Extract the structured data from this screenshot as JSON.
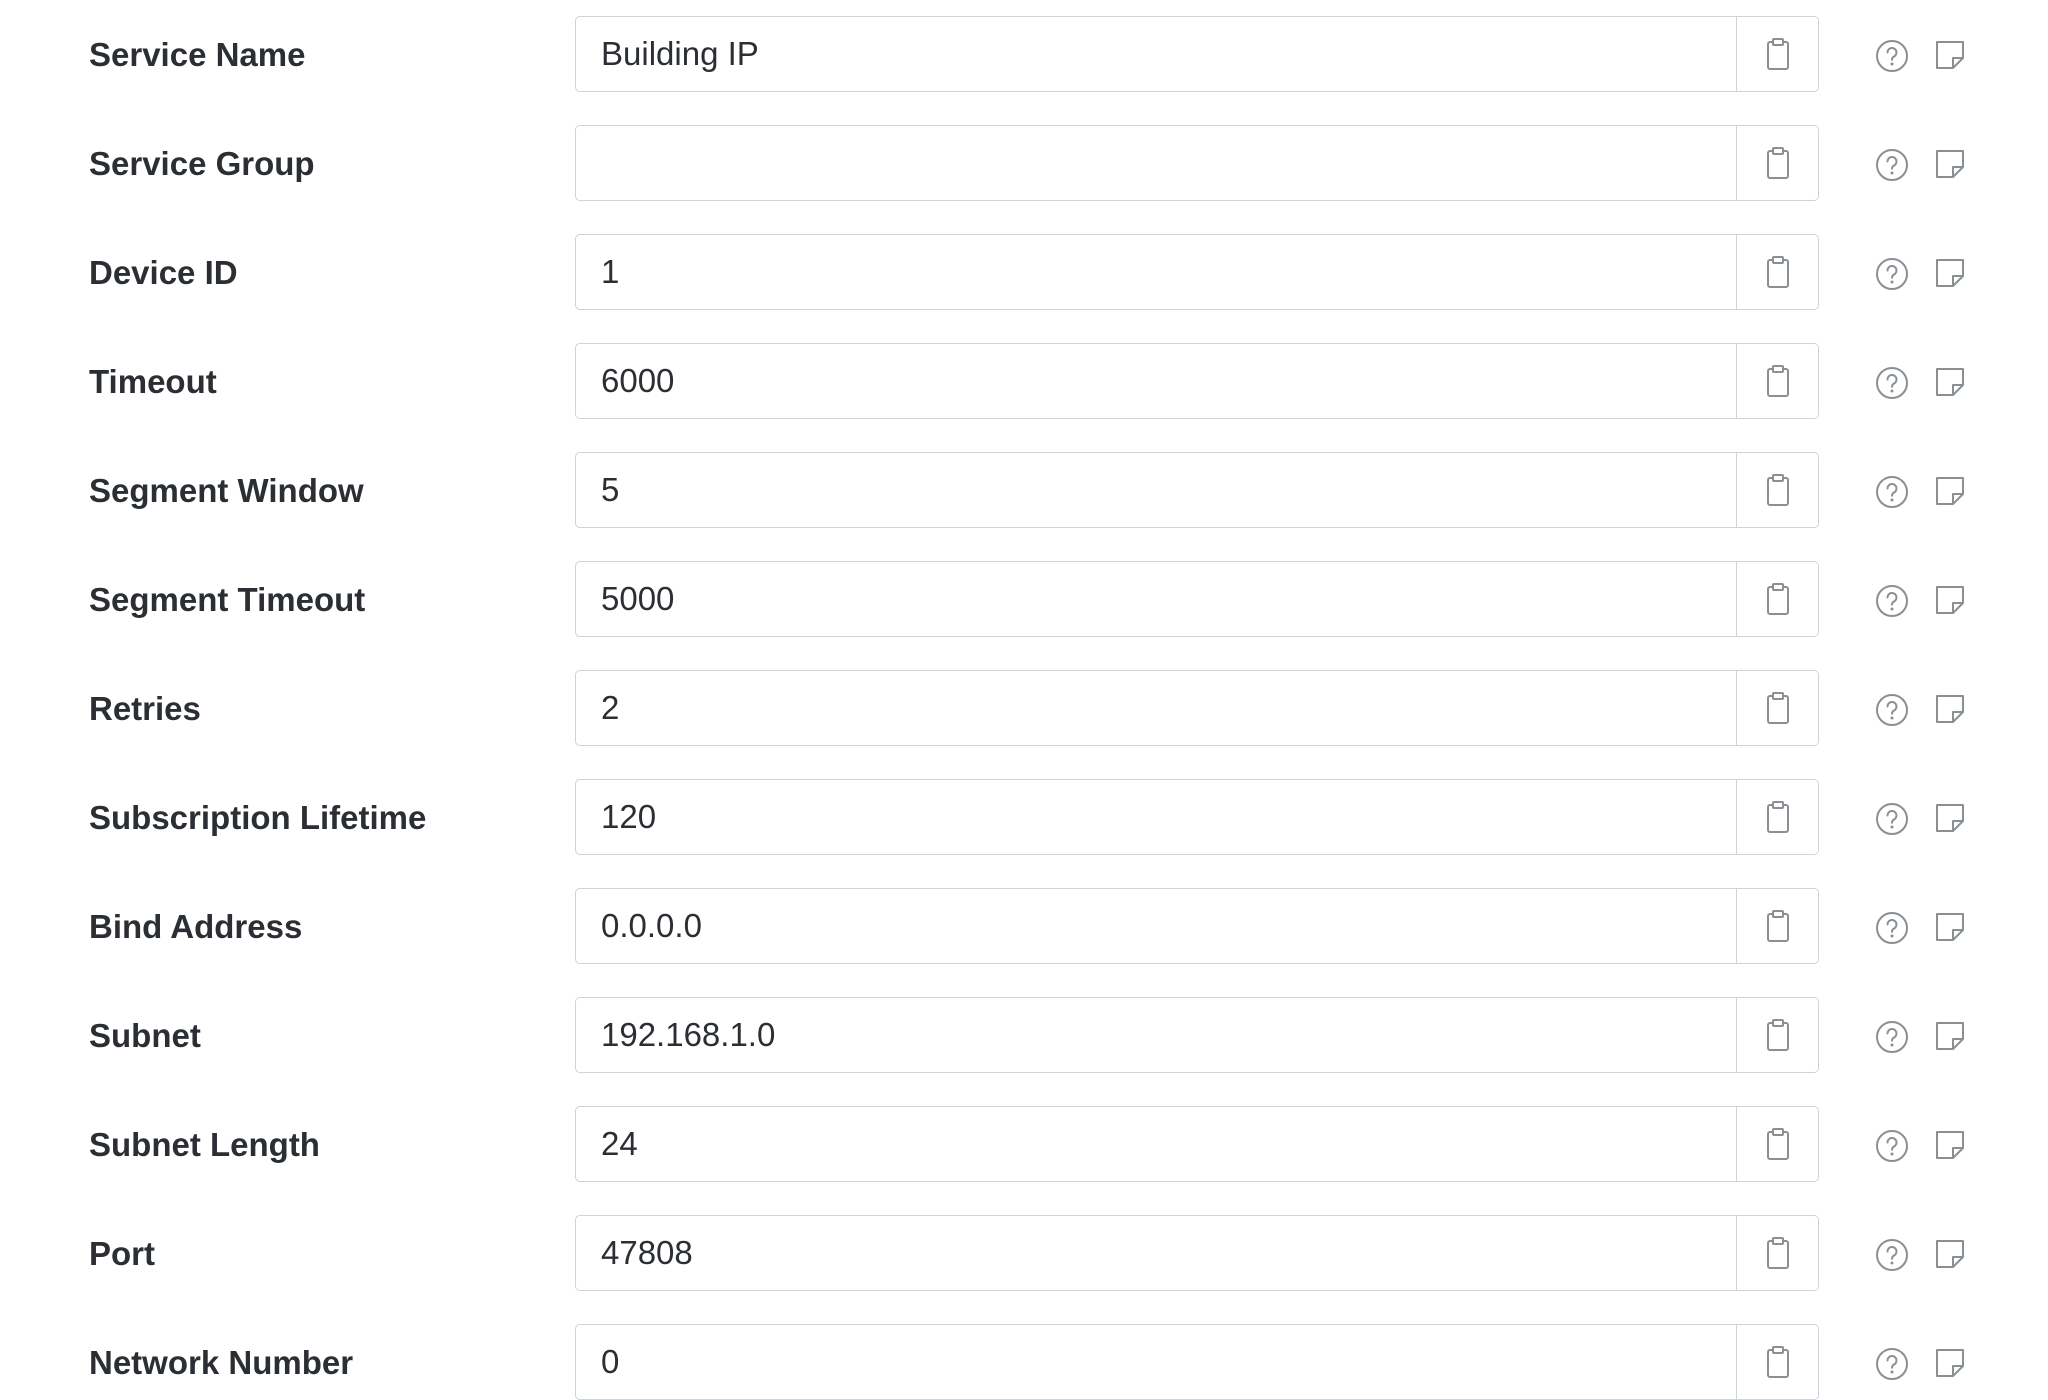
{
  "fields": [
    {
      "label": "Service Name",
      "value": "Building IP"
    },
    {
      "label": "Service Group",
      "value": ""
    },
    {
      "label": "Device ID",
      "value": "1"
    },
    {
      "label": "Timeout",
      "value": "6000"
    },
    {
      "label": "Segment Window",
      "value": "5"
    },
    {
      "label": "Segment Timeout",
      "value": "5000"
    },
    {
      "label": "Retries",
      "value": "2"
    },
    {
      "label": "Subscription Lifetime",
      "value": "120"
    },
    {
      "label": "Bind Address",
      "value": "0.0.0.0"
    },
    {
      "label": "Subnet",
      "value": "192.168.1.0"
    },
    {
      "label": "Subnet Length",
      "value": "24"
    },
    {
      "label": "Port",
      "value": "47808"
    },
    {
      "label": "Network Number",
      "value": "0"
    }
  ],
  "icons": {
    "paste": "clipboard-icon",
    "help": "help-circle-icon",
    "note": "sticky-note-icon"
  },
  "colors": {
    "label_text": "#2b2f33",
    "border": "#cfd3d7",
    "icon": "#8a8f94"
  }
}
